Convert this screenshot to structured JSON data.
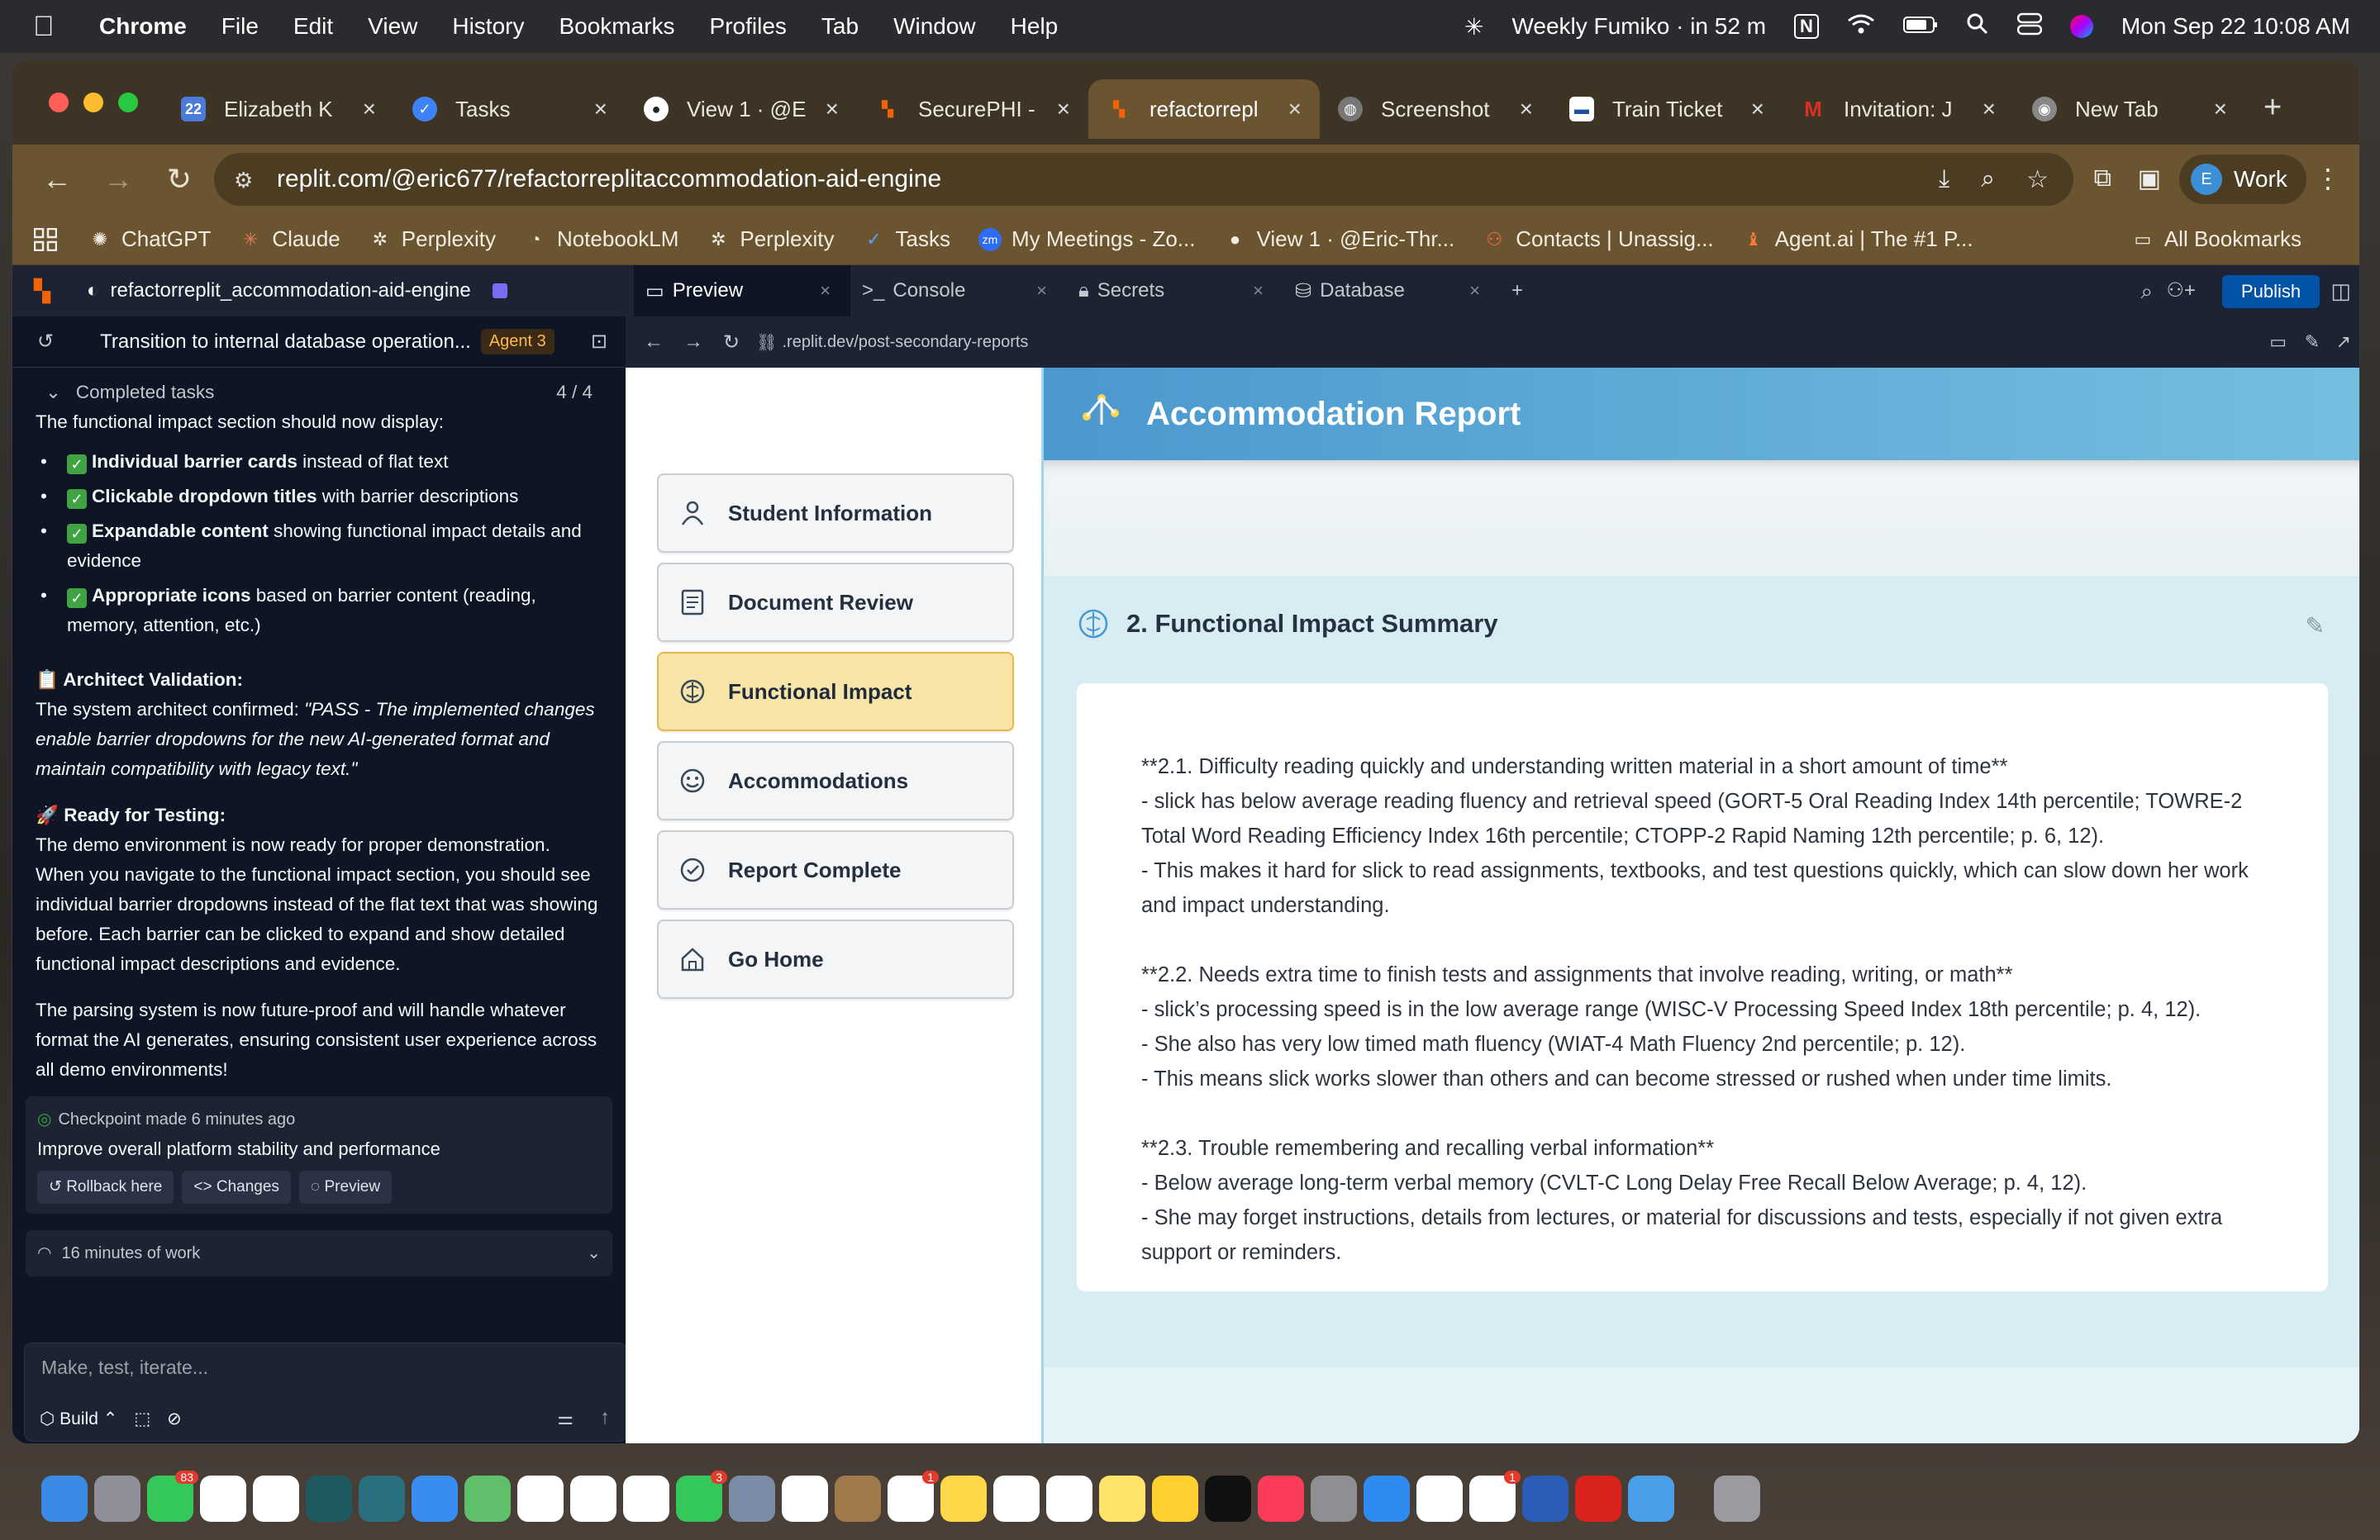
{
  "menubar": {
    "app": "Chrome",
    "items": [
      "File",
      "Edit",
      "View",
      "History",
      "Bookmarks",
      "Profiles",
      "Tab",
      "Window",
      "Help"
    ],
    "event": "Weekly Fumiko · in 52 m",
    "datetime": "Mon Sep 22  10:08 AM"
  },
  "tabs": [
    {
      "label": "Elizabeth K",
      "icon": "calendar-icon",
      "color": "#4a7bd8"
    },
    {
      "label": "Tasks",
      "icon": "tasks-icon",
      "color": "#3e82f7"
    },
    {
      "label": "View 1 · @E",
      "icon": "github-icon",
      "color": "#222222"
    },
    {
      "label": "SecurePHI -",
      "icon": "replit-icon",
      "color": "#f26207"
    },
    {
      "label": "refactorrepl",
      "icon": "replit-icon",
      "color": "#f26207"
    },
    {
      "label": "Screenshot",
      "icon": "globe-icon",
      "color": "#777777"
    },
    {
      "label": "Train Ticket",
      "icon": "train-icon",
      "color": "#1b4fa0"
    },
    {
      "label": "Invitation: J",
      "icon": "gmail-icon",
      "color": "#d93025"
    },
    {
      "label": "New Tab",
      "icon": "chrome-icon",
      "color": "#888888"
    }
  ],
  "url": "replit.com/@eric677/refactorreplitaccommodation-aid-engine",
  "profile": {
    "initial": "E",
    "label": "Work"
  },
  "bookmarks": [
    {
      "label": "ChatGPT",
      "icon": "chatgpt-icon"
    },
    {
      "label": "Claude",
      "icon": "claude-icon"
    },
    {
      "label": "Perplexity",
      "icon": "perplexity-icon"
    },
    {
      "label": "NotebookLM",
      "icon": "notebooklm-icon"
    },
    {
      "label": "Perplexity",
      "icon": "perplexity-icon"
    },
    {
      "label": "Tasks",
      "icon": "tasks-icon"
    },
    {
      "label": "My Meetings - Zo...",
      "icon": "zoom-icon"
    },
    {
      "label": "View 1 · @Eric-Thr...",
      "icon": "github-icon"
    },
    {
      "label": "Contacts | Unassig...",
      "icon": "contacts-icon"
    },
    {
      "label": "Agent.ai | The #1 P...",
      "icon": "agent-icon"
    }
  ],
  "all_bookmarks": "All Bookmarks",
  "replit": {
    "project": "refactorreplit_accommodation-aid-engine",
    "tabs": [
      "Preview",
      "Console",
      "Secrets",
      "Database"
    ],
    "publish": "Publish",
    "agent_title": "Transition to internal database operation...",
    "agent_badge": "Agent 3",
    "preview_url": ".replit.dev/post-secondary-reports",
    "chat": {
      "completed": "Completed tasks",
      "completed_count": "4 / 4",
      "intro": "The functional impact section should now display:",
      "bullets": [
        {
          "bold": "Individual barrier cards",
          "rest": " instead of flat text"
        },
        {
          "bold": "Clickable dropdown titles",
          "rest": " with barrier descriptions"
        },
        {
          "bold": "Expandable content",
          "rest": " showing functional impact details and evidence"
        },
        {
          "bold": "Appropriate icons",
          "rest": " based on barrier content (reading, memory, attention, etc.)"
        }
      ],
      "arch_heading": "📋 Architect Validation:",
      "arch_prefix": "The system architect confirmed: ",
      "arch_quote": "\"PASS - The implemented changes enable barrier dropdowns for the new AI-generated format and maintain compatibility with legacy text.\"",
      "ready_heading": "🚀 Ready for Testing:",
      "ready_text": "The demo environment is now ready for proper demonstration. When you navigate to the functional impact section, you should see individual barrier dropdowns instead of the flat text that was showing before. Each barrier can be clicked to expand and show detailed functional impact descriptions and evidence.",
      "parsing_text": "The parsing system is now future-proof and will handle whatever format the AI generates, ensuring consistent user experience across all demo environments!",
      "checkpoint_time": "Checkpoint made 6 minutes ago",
      "checkpoint_msg": "Improve overall platform stability and performance",
      "rollback": "Rollback here",
      "changes": "Changes",
      "preview": "Preview",
      "work_time": "16 minutes of work"
    },
    "input_placeholder": "Make, test, iterate...",
    "build": "Build"
  },
  "app": {
    "header_title": "Accommodation Report",
    "nav": [
      {
        "label": "Student Information",
        "icon": "student-icon",
        "active": false
      },
      {
        "label": "Document Review",
        "icon": "document-icon",
        "active": false
      },
      {
        "label": "Functional Impact",
        "icon": "brain-icon",
        "active": true
      },
      {
        "label": "Accommodations",
        "icon": "accommodations-icon",
        "active": false
      },
      {
        "label": "Report Complete",
        "icon": "check-circle-icon",
        "active": false
      },
      {
        "label": "Go Home",
        "icon": "home-icon",
        "active": false
      }
    ],
    "section_title": "2. Functional Impact Summary",
    "paragraphs": [
      [
        "**2.1. Difficulty reading quickly and understanding written material in a short amount of time**",
        "- slick has below average reading fluency and retrieval speed (GORT-5 Oral Reading Index 14th percentile; TOWRE-2 Total Word Reading Efficiency Index 16th percentile; CTOPP-2 Rapid Naming 12th percentile; p. 6, 12).",
        "- This makes it hard for slick to read assignments, textbooks, and test questions quickly, which can slow down her work and impact understanding."
      ],
      [
        "**2.2. Needs extra time to finish tests and assignments that involve reading, writing, or math**",
        "- slick’s processing speed is in the low average range (WISC-V Processing Speed Index 18th percentile; p. 4, 12).",
        "- She also has very low timed math fluency (WIAT-4 Math Fluency 2nd percentile; p. 12).",
        "- This means slick works slower than others and can become stressed or rushed when under time limits."
      ],
      [
        "**2.3. Trouble remembering and recalling verbal information**",
        "- Below average long-term verbal memory (CVLT-C Long Delay Free Recall Below Average; p. 4, 12).",
        "- She may forget instructions, details from lectures, or material for discussions and tests, especially if not given extra support or reminders."
      ]
    ]
  },
  "dock": [
    {
      "icon": "finder-icon",
      "color": "#3b8be6"
    },
    {
      "icon": "launchpad-icon",
      "color": "#8f8f9a"
    },
    {
      "icon": "messages-icon",
      "color": "#34c759",
      "badge": "83"
    },
    {
      "icon": "notion-icon",
      "color": "#ffffff"
    },
    {
      "icon": "calendar-icon",
      "color": "#ffffff"
    },
    {
      "icon": "perplexity-icon",
      "color": "#1f5a60"
    },
    {
      "icon": "claude-icon",
      "color": "#2a6f80"
    },
    {
      "icon": "mail-icon",
      "color": "#3a8df0"
    },
    {
      "icon": "maps-icon",
      "color": "#5fbf6a"
    },
    {
      "icon": "xcode-icon",
      "color": "#ffffff"
    },
    {
      "icon": "chrome-icon",
      "color": "#ffffff"
    },
    {
      "icon": "calendar-icon",
      "color": "#ffffff"
    },
    {
      "icon": "facetime-icon",
      "color": "#34c759",
      "badge": "3"
    },
    {
      "icon": "preview-icon",
      "color": "#7b8da6"
    },
    {
      "icon": "notion-calendar-icon",
      "color": "#ffffff"
    },
    {
      "icon": "contacts-icon",
      "color": "#a07a4a"
    },
    {
      "icon": "reminders-icon",
      "color": "#ffffff",
      "badge": "1"
    },
    {
      "icon": "notes-icon",
      "color": "#ffd84a"
    },
    {
      "icon": "photos-icon",
      "color": "#ffffff"
    },
    {
      "icon": "chatgpt-icon",
      "color": "#ffffff"
    },
    {
      "icon": "stickies-icon",
      "color": "#ffe36b"
    },
    {
      "icon": "miro-icon",
      "color": "#ffd02f"
    },
    {
      "icon": "appletv-icon",
      "color": "#111111"
    },
    {
      "icon": "music-icon",
      "color": "#fa3c5a"
    },
    {
      "icon": "settings-icon",
      "color": "#8e8e93"
    },
    {
      "icon": "appstore-icon",
      "color": "#2e8cf0"
    },
    {
      "icon": "pdf-icon",
      "color": "#ffffff"
    },
    {
      "icon": "slack-icon",
      "color": "#ffffff",
      "badge": "1"
    },
    {
      "icon": "word-icon",
      "color": "#2b5cb8"
    },
    {
      "icon": "acrobat-icon",
      "color": "#d9231c"
    },
    {
      "icon": "cloud-icon",
      "color": "#4a9fe8"
    },
    {
      "icon": "trash-icon",
      "color": "#9a9aa0"
    }
  ]
}
